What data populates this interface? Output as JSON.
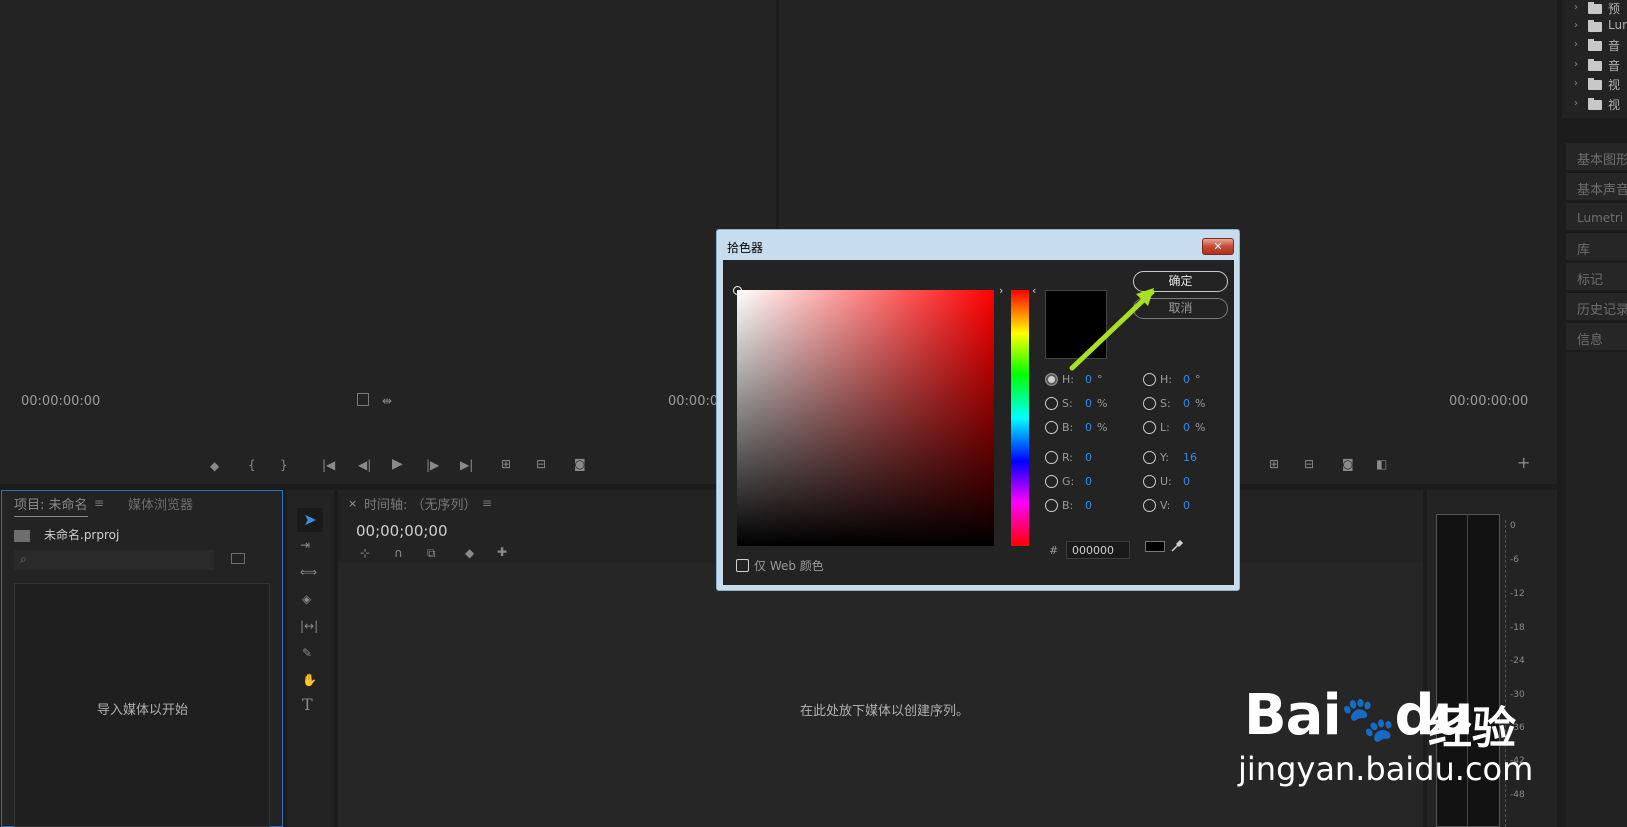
{
  "program": {
    "source_monitor": {
      "timecode": "00:00:00:00"
    },
    "program_monitor": {
      "timecode": "00:00:0",
      "timecode_right": "00:00:00:00"
    }
  },
  "right_panel": {
    "items": [
      {
        "label": "预"
      },
      {
        "label": "Lun"
      },
      {
        "label": "音"
      },
      {
        "label": "音"
      },
      {
        "label": "视"
      },
      {
        "label": "视"
      }
    ],
    "panels": [
      "基本图形",
      "基本声音",
      "Lumetri 颜",
      "库",
      "标记",
      "历史记录",
      "信息"
    ]
  },
  "project_panel": {
    "tab_project": "项目: 未命名",
    "tab_media": "媒体浏览器",
    "file_name": "未命名.prproj",
    "search_placeholder": "",
    "empty_hint": "导入媒体以开始"
  },
  "timeline_panel": {
    "tab_close": "×",
    "tab_title": "时间轴: （无序列）",
    "timecode": "00;00;00;00",
    "empty_hint": "在此处放下媒体以创建序列。"
  },
  "dialog": {
    "title": "拾色器",
    "close": "✕",
    "ok": "确定",
    "cancel": "取消",
    "web_only": "仅 Web 颜色",
    "hex_label": "#",
    "hex_value": "000000",
    "fields_left": [
      {
        "label": "H:",
        "value": "0",
        "unit": "°",
        "selected": true
      },
      {
        "label": "S:",
        "value": "0",
        "unit": "%",
        "selected": false
      },
      {
        "label": "B:",
        "value": "0",
        "unit": "%",
        "selected": false
      },
      {
        "label": "R:",
        "value": "0",
        "unit": "",
        "selected": false
      },
      {
        "label": "G:",
        "value": "0",
        "unit": "",
        "selected": false
      },
      {
        "label": "B:",
        "value": "0",
        "unit": "",
        "selected": false
      }
    ],
    "fields_right": [
      {
        "label": "H:",
        "value": "0",
        "unit": "°",
        "selected": false
      },
      {
        "label": "S:",
        "value": "0",
        "unit": "%",
        "selected": false
      },
      {
        "label": "L:",
        "value": "0",
        "unit": "%",
        "selected": false
      },
      {
        "label": "Y:",
        "value": "16",
        "unit": "",
        "selected": false
      },
      {
        "label": "U:",
        "value": "0",
        "unit": "",
        "selected": false
      },
      {
        "label": "V:",
        "value": "0",
        "unit": "",
        "selected": false
      }
    ],
    "current_color": "#000000"
  },
  "audio_meter": {
    "ticks": [
      "0",
      "-6",
      "-12",
      "-18",
      "-24",
      "-30",
      "-36",
      "-42",
      "-48"
    ]
  },
  "watermark": {
    "brand": "Bai",
    "brand2": "du",
    "cn": "经验",
    "url": "jingyan.baidu.com"
  },
  "colors": {
    "accent": "#2d8ceb",
    "annotation_arrow": "#a8e022",
    "background": "#232323"
  },
  "icons": [
    "marker-icon",
    "in-point-icon",
    "out-point-icon",
    "go-to-in-icon",
    "step-back-icon",
    "play-icon",
    "step-forward-icon",
    "go-to-out-icon",
    "insert-icon",
    "overwrite-icon",
    "camera-icon",
    "add-icon",
    "eyedropper-icon",
    "search-icon",
    "new-bin-icon"
  ]
}
